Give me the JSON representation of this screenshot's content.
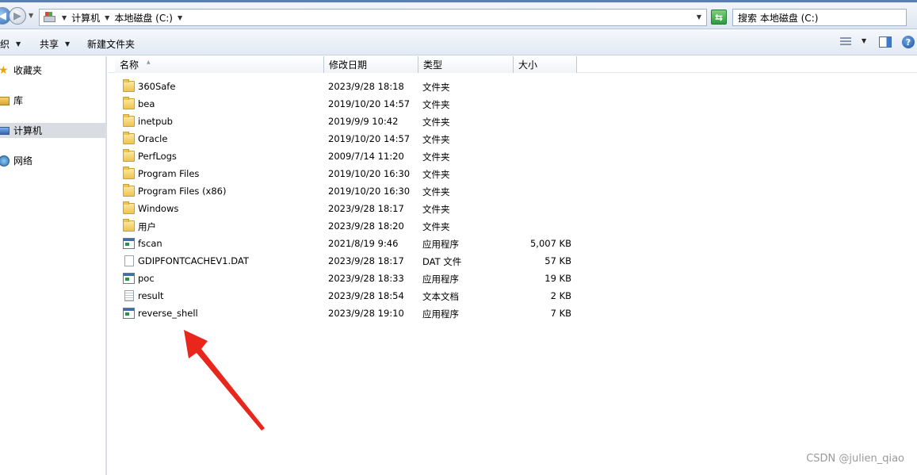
{
  "address": {
    "segments": [
      "计算机",
      "本地磁盘 (C:)"
    ],
    "search_placeholder": "搜索 本地磁盘 (C:)"
  },
  "toolbar": {
    "organize": "织",
    "share": "共享",
    "new_folder": "新建文件夹"
  },
  "nav": {
    "favorites": "收藏夹",
    "libraries": "库",
    "computer": "计算机",
    "network": "网络"
  },
  "columns": {
    "name": "名称",
    "date": "修改日期",
    "type": "类型",
    "size": "大小"
  },
  "files": [
    {
      "name": "360Safe",
      "date": "2023/9/28 18:18",
      "type": "文件夹",
      "size": "",
      "icon": "folder-icon"
    },
    {
      "name": "bea",
      "date": "2019/10/20 14:57",
      "type": "文件夹",
      "size": "",
      "icon": "folder-icon"
    },
    {
      "name": "inetpub",
      "date": "2019/9/9 10:42",
      "type": "文件夹",
      "size": "",
      "icon": "folder-icon"
    },
    {
      "name": "Oracle",
      "date": "2019/10/20 14:57",
      "type": "文件夹",
      "size": "",
      "icon": "folder-icon"
    },
    {
      "name": "PerfLogs",
      "date": "2009/7/14 11:20",
      "type": "文件夹",
      "size": "",
      "icon": "folder-icon"
    },
    {
      "name": "Program Files",
      "date": "2019/10/20 16:30",
      "type": "文件夹",
      "size": "",
      "icon": "folder-icon"
    },
    {
      "name": "Program Files (x86)",
      "date": "2019/10/20 16:30",
      "type": "文件夹",
      "size": "",
      "icon": "folder-icon"
    },
    {
      "name": "Windows",
      "date": "2023/9/28 18:17",
      "type": "文件夹",
      "size": "",
      "icon": "folder-icon"
    },
    {
      "name": "用户",
      "date": "2023/9/28 18:20",
      "type": "文件夹",
      "size": "",
      "icon": "folder-icon"
    },
    {
      "name": "fscan",
      "date": "2021/8/19 9:46",
      "type": "应用程序",
      "size": "5,007 KB",
      "icon": "application-icon"
    },
    {
      "name": "GDIPFONTCACHEV1.DAT",
      "date": "2023/9/28 18:17",
      "type": "DAT 文件",
      "size": "57 KB",
      "icon": "file-icon"
    },
    {
      "name": "poc",
      "date": "2023/9/28 18:33",
      "type": "应用程序",
      "size": "19 KB",
      "icon": "application-icon"
    },
    {
      "name": "result",
      "date": "2023/9/28 18:54",
      "type": "文本文档",
      "size": "2 KB",
      "icon": "text-document-icon"
    },
    {
      "name": "reverse_shell",
      "date": "2023/9/28 19:10",
      "type": "应用程序",
      "size": "7 KB",
      "icon": "application-icon"
    }
  ],
  "watermark": "CSDN @julien_qiao",
  "colors": {
    "annotation_arrow": "#e8261c",
    "selection": "#d9dde3"
  }
}
